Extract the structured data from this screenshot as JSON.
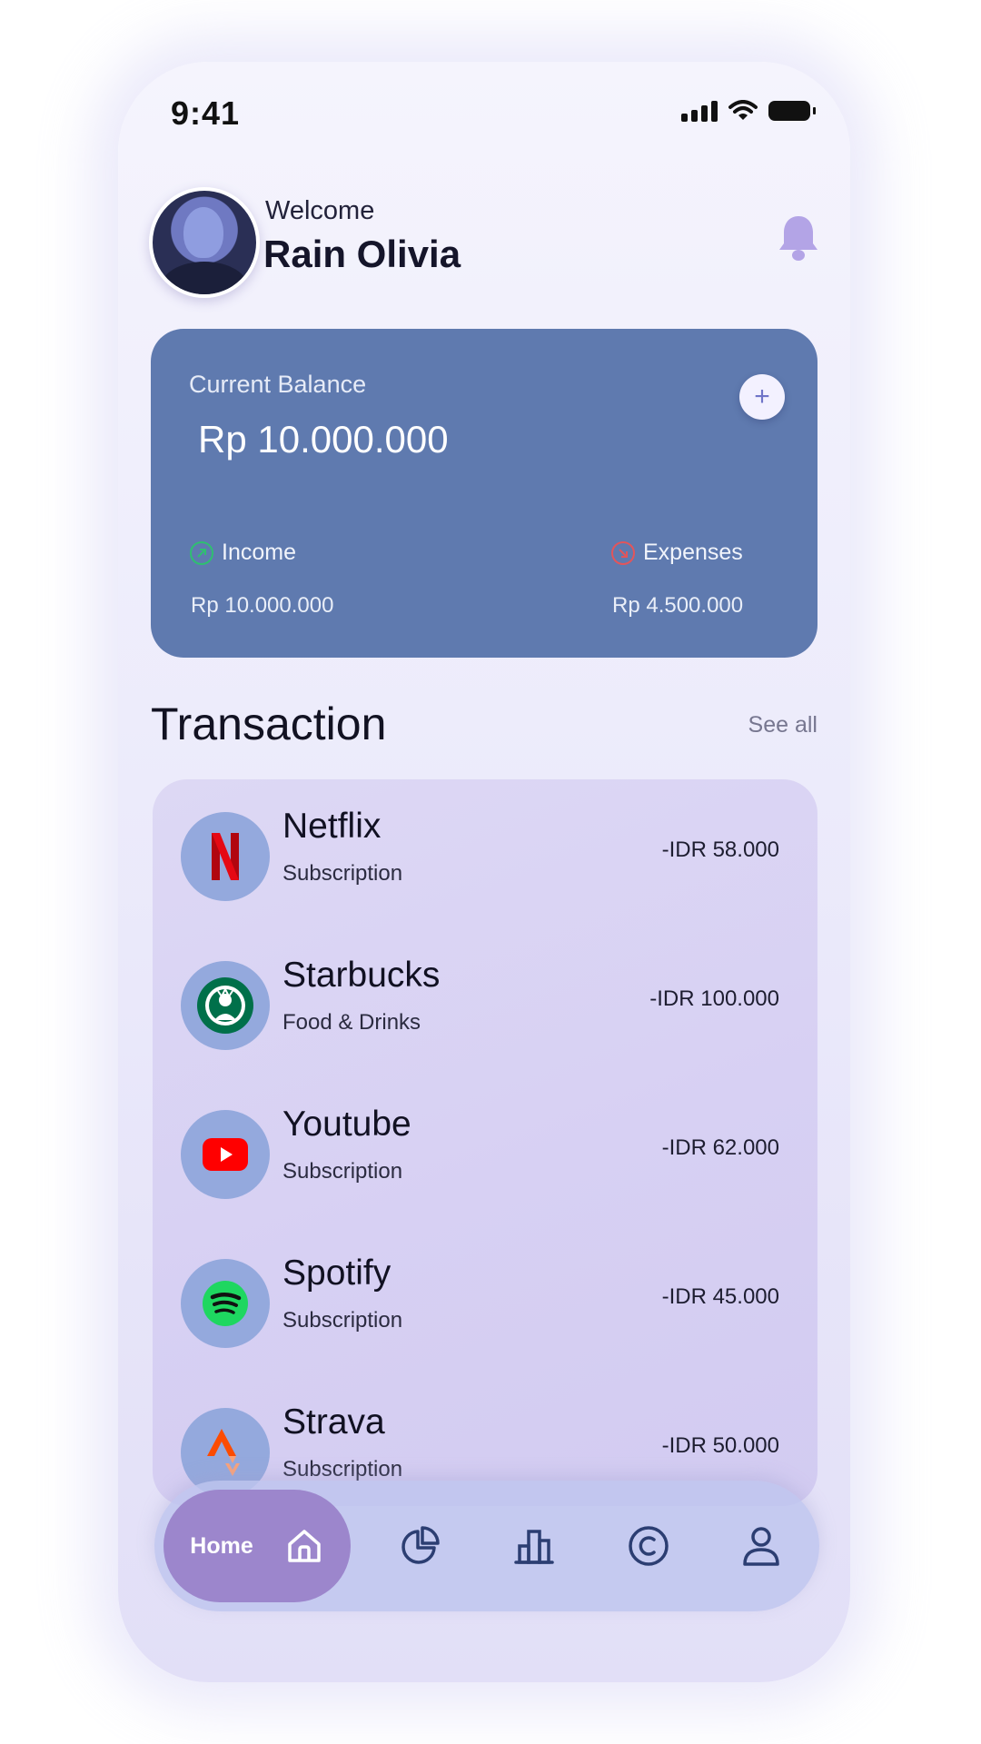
{
  "status_bar": {
    "time": "9:41"
  },
  "profile": {
    "greeting": "Welcome",
    "name": "Rain Olivia"
  },
  "balance_card": {
    "label": "Current Balance",
    "amount": "Rp 10.000.000",
    "income_label": "Income",
    "income_value": "Rp 10.000.000",
    "expenses_label": "Expenses",
    "expenses_value": "Rp 4.500.000"
  },
  "transactions": {
    "title": "Transaction",
    "see_all": "See all",
    "items": [
      {
        "name": "Netflix",
        "category": "Subscription",
        "amount": "-IDR 58.000",
        "icon": "netflix-icon"
      },
      {
        "name": "Starbucks",
        "category": "Food & Drinks",
        "amount": "-IDR 100.000",
        "icon": "starbucks-icon"
      },
      {
        "name": "Youtube",
        "category": "Subscription",
        "amount": "-IDR 62.000",
        "icon": "youtube-icon"
      },
      {
        "name": "Spotify",
        "category": "Subscription",
        "amount": "-IDR 45.000",
        "icon": "spotify-icon"
      },
      {
        "name": "Strava",
        "category": "Subscription",
        "amount": "-IDR 50.000",
        "icon": "strava-icon"
      }
    ]
  },
  "bottom_nav": {
    "active_label": "Home",
    "items": [
      "home-icon",
      "pie-chart-icon",
      "bar-chart-icon",
      "currency-icon",
      "profile-icon"
    ]
  },
  "colors": {
    "card": "#5f7aaf",
    "income": "#2fbf71",
    "expenses": "#e2555b",
    "nav_active": "#9c86cc",
    "accent": "#b3a4e6"
  }
}
